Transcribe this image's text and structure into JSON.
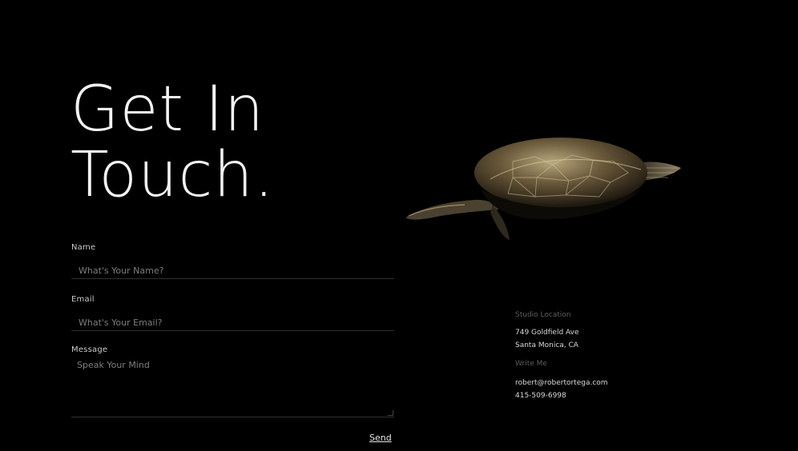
{
  "hero": {
    "line1": "Get In",
    "line2": "Touch."
  },
  "form": {
    "name": {
      "label": "Name",
      "placeholder": "What's Your Name?"
    },
    "email": {
      "label": "Email",
      "placeholder": "What's Your Email?"
    },
    "message": {
      "label": "Message",
      "placeholder": "Speak Your Mind"
    },
    "send_label": "Send"
  },
  "contact": {
    "studio_heading": "Studio Location",
    "address_line1": "749 Goldfield Ave",
    "address_line2": "Santa Monica, CA",
    "write_heading": "Write Me",
    "email": "robert@robertortega.com",
    "phone": "415-509-6998"
  },
  "image": {
    "icon": "turtle-illustration"
  }
}
